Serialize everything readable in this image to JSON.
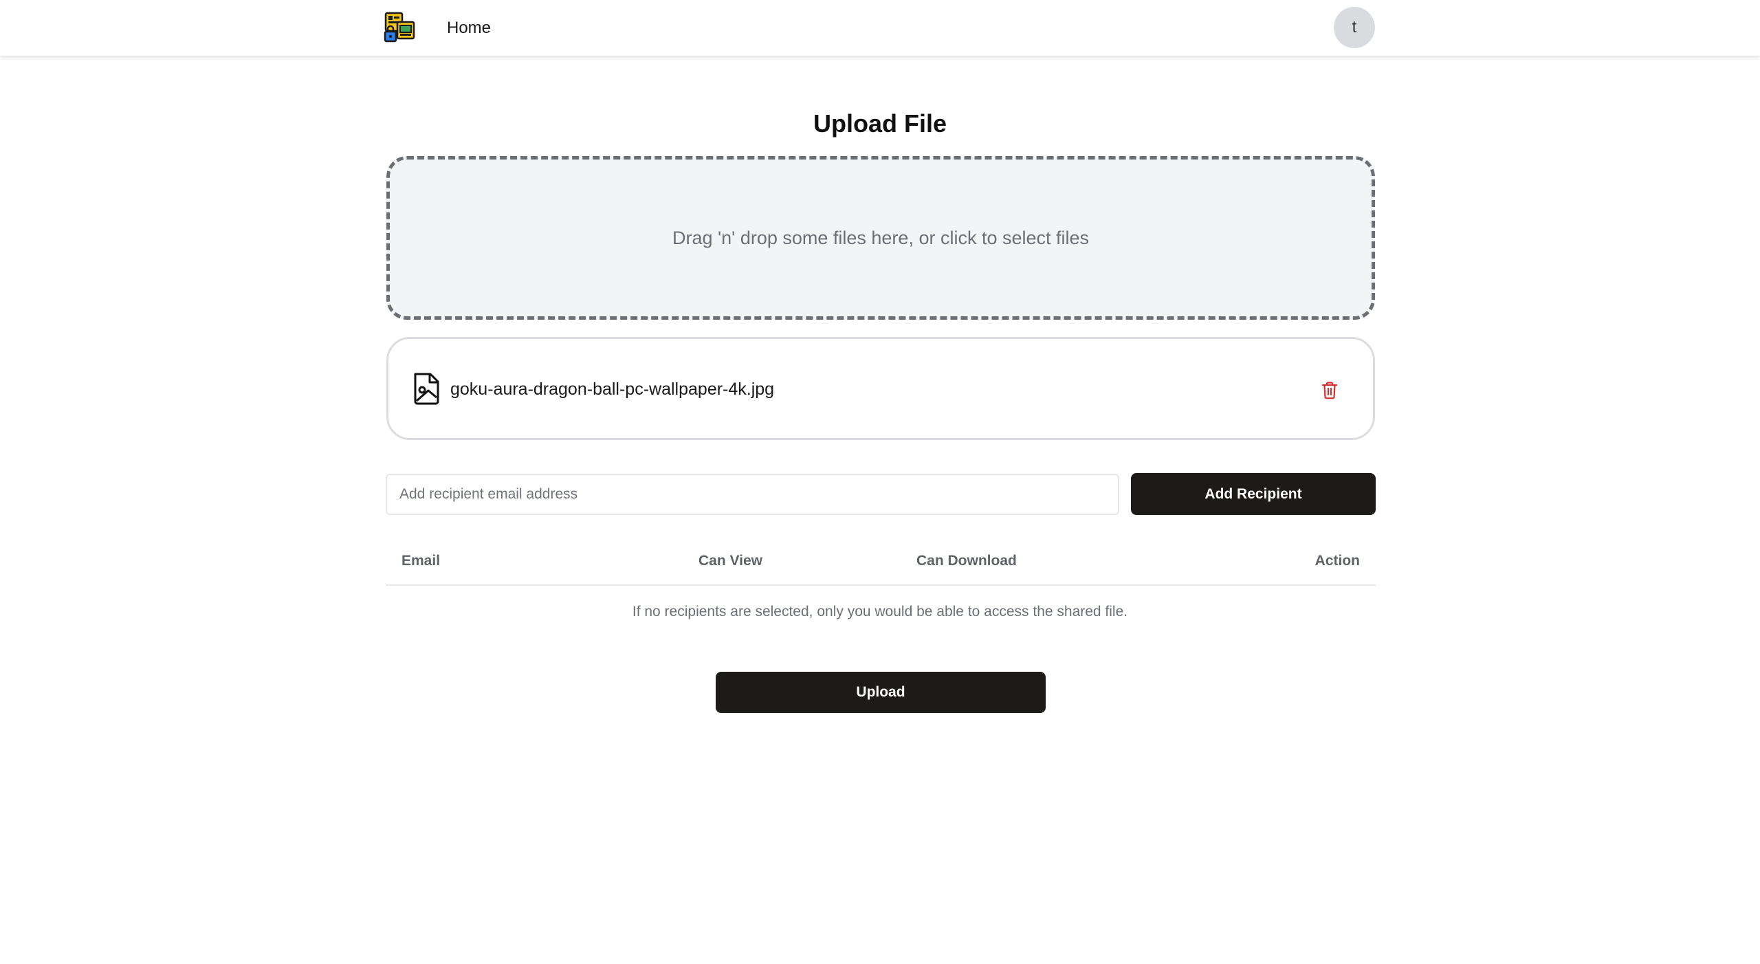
{
  "header": {
    "home_label": "Home",
    "avatar_initial": "t"
  },
  "main": {
    "title": "Upload File",
    "dropzone_text": "Drag 'n' drop some files here, or click to select files",
    "file": {
      "name": "goku-aura-dragon-ball-pc-wallpaper-4k.jpg",
      "icon": "image-file-icon",
      "delete_icon": "trash-icon"
    },
    "recipient": {
      "placeholder": "Add recipient email address",
      "add_label": "Add Recipient"
    },
    "table": {
      "columns": [
        "Email",
        "Can View",
        "Can Download",
        "Action"
      ],
      "empty_message": "If no recipients are selected, only you would be able to access the shared file."
    },
    "upload_label": "Upload"
  },
  "colors": {
    "primary_button": "#1c1b1a",
    "dropzone_bg": "#f3f4f6",
    "dropzone_border": "#6b6e73",
    "delete": "#d32f2f",
    "logo_yellow": "#f5c518",
    "logo_green": "#3aa655",
    "logo_blue": "#2d7be5"
  }
}
